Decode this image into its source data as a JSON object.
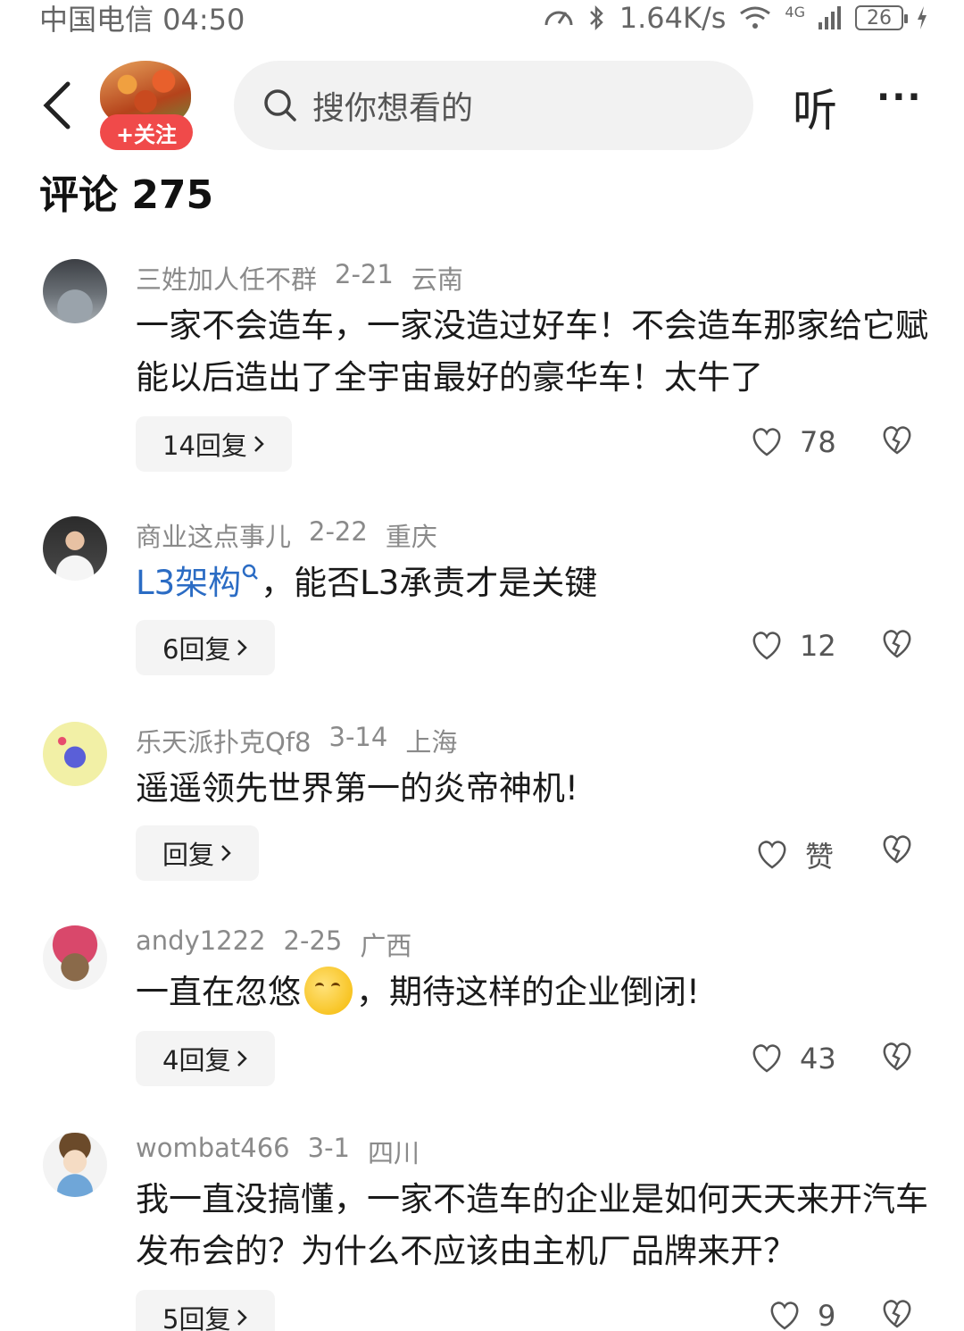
{
  "status_bar": {
    "carrier_time": "中国电信 04:50",
    "network_speed": "1.64K/s",
    "signal_label": "4G",
    "battery": "26"
  },
  "header": {
    "follow_label": "+关注",
    "search_placeholder": "搜你想看的",
    "listen_label": "听",
    "more_label": "···"
  },
  "comments_title": "评论 275",
  "comments": [
    {
      "user": "三姓加人任不群",
      "date": "2-21",
      "location": "云南",
      "text": "一家不会造车，一家没造过好车！不会造车那家给它赋能以后造出了全宇宙最好的豪华车！太牛了",
      "replies": "14回复",
      "likes": "78"
    },
    {
      "user": "商业这点事儿",
      "date": "2-22",
      "location": "重庆",
      "link_text": "L3架构",
      "text": "，能否L3承责才是关键",
      "replies": "6回复",
      "likes": "12"
    },
    {
      "user": "乐天派扑克Qf8",
      "date": "3-14",
      "location": "上海",
      "text": "遥遥领先世界第一的炎帝神机!",
      "replies": "回复",
      "likes": "赞"
    },
    {
      "user": "andy1222",
      "date": "2-25",
      "location": "广西",
      "text_before": "一直在忽悠",
      "text_after": "，期待这样的企业倒闭!",
      "replies": "4回复",
      "likes": "43"
    },
    {
      "user": "wombat466",
      "date": "3-1",
      "location": "四川",
      "text": "我一直没搞懂，一家不造车的企业是如何天天来开汽车发布会的？为什么不应该由主机厂品牌来开？",
      "replies": "5回复",
      "likes": "9"
    }
  ]
}
